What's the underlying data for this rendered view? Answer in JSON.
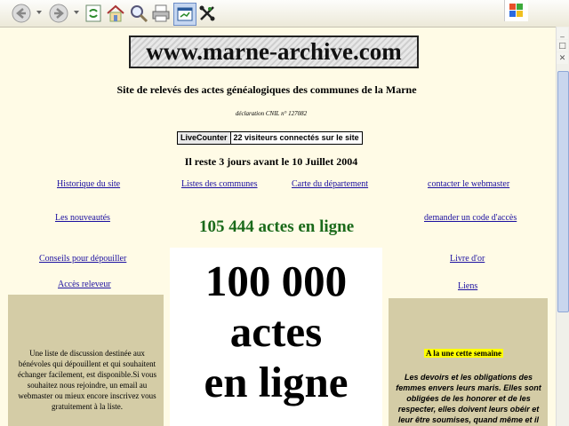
{
  "toolbar": {
    "buttons": [
      "back-icon",
      "forward-icon",
      "refresh-icon",
      "home-icon",
      "search-icon",
      "print-icon",
      "window-icon",
      "tools-icon"
    ]
  },
  "site": {
    "logo": "www.marne-archive.com",
    "subtitle": "Site de relevés des actes généalogiques des communes de la Marne",
    "cnil": "déclaration CNIL n° 127082",
    "counter_label": "LiveCounter",
    "counter_text": "22 visiteurs connectés sur le site",
    "countdown": "Il reste 3 jours avant le 10 Juillet 2004"
  },
  "links": {
    "histoire": "Historique du site",
    "listes": "Listes des communes",
    "carte": "Carte du département",
    "contact": "contacter le webmaster",
    "nouveautes": "Les nouveautés",
    "code": "demander un code d'accès",
    "conseils": "Conseils pour dépouiller",
    "livre": "Livre d'or",
    "acces": "Accès releveur",
    "liens": "Liens"
  },
  "headline": "105 444 actes en ligne",
  "banner": {
    "line1": "100 000",
    "line2": "actes",
    "line3": "en ligne"
  },
  "left_panel": {
    "text": "Une liste de discussion destinée aux bénévoles qui dépouillent et qui souhaitent échanger facilement, est disponible.Si vous souhaitez nous rejoindre, un email au webmaster ou mieux encore inscrivez vous gratuitement à la liste."
  },
  "right_panel": {
    "title": "A la une cette semaine",
    "text": "Les devoirs et les obligations des femmes envers leurs maris. Elles sont obligées de les honorer et de les respecter, elles doivent leurs obéir et leur être soumises, quand même et il"
  },
  "window_controls": {
    "minimize": "_",
    "maximize": "□",
    "close": "✕"
  }
}
